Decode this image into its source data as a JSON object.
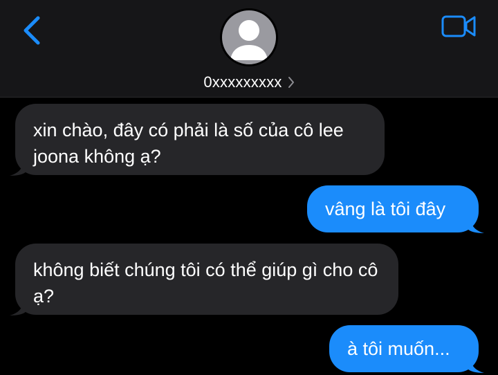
{
  "header": {
    "back_icon": "chevron-left-icon",
    "video_icon": "video-camera-icon",
    "avatar_icon": "person-silhouette-icon",
    "contact_name": "0xxxxxxxxx",
    "contact_chevron_icon": "chevron-right-icon"
  },
  "colors": {
    "accent": "#1b8cfb",
    "incoming_bubble": "#262629",
    "header_bg": "#161618",
    "background": "#000000"
  },
  "messages": [
    {
      "direction": "incoming",
      "text": "xin chào, đây có phải là số của cô lee joona không ạ?"
    },
    {
      "direction": "outgoing",
      "text": "vâng là tôi đây"
    },
    {
      "direction": "incoming",
      "text": "không biết chúng tôi có thể giúp gì cho cô ạ?"
    },
    {
      "direction": "outgoing",
      "text": "à tôi muốn..."
    }
  ]
}
